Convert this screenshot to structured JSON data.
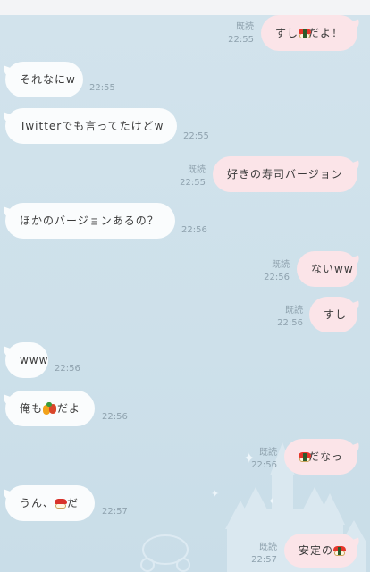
{
  "read_label": "既読",
  "messages": [
    {
      "side": "out",
      "text_before": "すし",
      "emoji": "sushi",
      "text_after": "だよ！",
      "time": "22:55",
      "read": true
    },
    {
      "side": "in",
      "text_before": "それなにw",
      "emoji": "",
      "text_after": "",
      "time": "22:55"
    },
    {
      "side": "in",
      "text_before": "Twitterでも言ってたけどw",
      "emoji": "",
      "text_after": "",
      "time": "22:55"
    },
    {
      "side": "out",
      "text_before": "好きの寿司バージョン",
      "emoji": "",
      "text_after": "",
      "time": "22:55",
      "read": true
    },
    {
      "side": "in",
      "text_before": "ほかのバージョンあるの？",
      "emoji": "",
      "text_after": "",
      "time": "22:56"
    },
    {
      "side": "out",
      "text_before": "ないww",
      "emoji": "",
      "text_after": "",
      "time": "22:56",
      "read": true
    },
    {
      "side": "out",
      "text_before": "すし",
      "emoji": "",
      "text_after": "",
      "time": "22:56",
      "read": true
    },
    {
      "side": "in",
      "text_before": "www",
      "emoji": "",
      "text_after": "",
      "time": "22:56"
    },
    {
      "side": "in",
      "text_before": "俺も",
      "emoji": "vegetables",
      "text_after": "だよ",
      "time": "22:56"
    },
    {
      "side": "out",
      "text_before": "",
      "emoji": "sushi",
      "text_after": "だなっ",
      "time": "22:56",
      "read": true
    },
    {
      "side": "in",
      "text_before": "うん、",
      "emoji": "sushi-roll",
      "text_after": "だ",
      "time": "22:57"
    },
    {
      "side": "out",
      "text_before": "安定の",
      "emoji": "sushi",
      "text_after": "",
      "time": "22:57",
      "read": true
    }
  ]
}
